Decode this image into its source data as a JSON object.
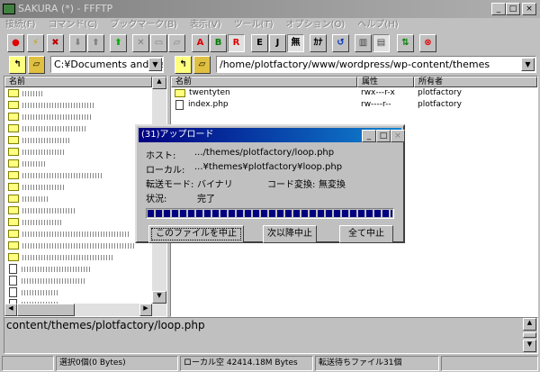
{
  "window": {
    "title": "SAKURA (*) - FFFTP",
    "min": "_",
    "max": "□",
    "close": "×"
  },
  "menu": [
    "接続(F)",
    "コマンド(C)",
    "ブックマーク(B)",
    "表示(V)",
    "ツール(T)",
    "オプション(O)",
    "ヘルプ(H)"
  ],
  "toolbar": {
    "ascii": "A",
    "binary": "B",
    "auto": "R",
    "euc": "E",
    "jis": "J",
    "none": "無",
    "kana": "ｶﾅ"
  },
  "local": {
    "path": "C:¥Documents and Se",
    "header": "名前",
    "folders": 15,
    "files": 7
  },
  "remote": {
    "path": "/home/plotfactory/www/wordpress/wp-content/themes",
    "columns": [
      "名前",
      "属性",
      "所有者"
    ],
    "rows": [
      {
        "name": "twentyten",
        "type": "folder",
        "attr": "rwx---r-x",
        "owner": "plotfactory"
      },
      {
        "name": "index.php",
        "type": "file",
        "attr": "rw----r--",
        "owner": "plotfactory"
      }
    ]
  },
  "dialog": {
    "title": "(31)アップロード",
    "host_label": "ホスト:",
    "host": ".../themes/plotfactory/loop.php",
    "local_label": "ローカル:",
    "local": "...¥themes¥plotfactory¥loop.php",
    "mode_label": "転送モード:",
    "mode": "バイナリ",
    "code_label": "コード変換:",
    "code": "無変換",
    "status_label": "状況:",
    "status": "完了",
    "progress": 100,
    "buttons": [
      "このファイルを中止",
      "次以降中止",
      "全て中止"
    ]
  },
  "log": "content/themes/plotfactory/loop.php",
  "statusbar": {
    "selected": "選択0個(0 Bytes)",
    "local_free": "ローカル空 42414.18M Bytes",
    "queue": "転送待ちファイル31個"
  }
}
